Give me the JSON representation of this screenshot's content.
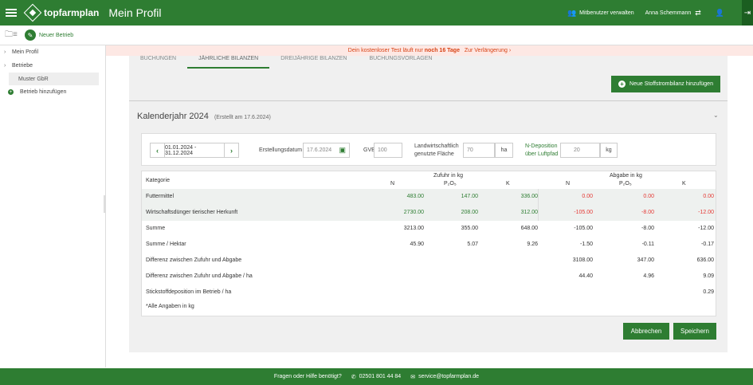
{
  "topbar": {
    "logo_text": "topfarmplan",
    "title": "Mein Profil",
    "mitbenutzer": "Mitbenutzer verwalten",
    "user": "Anna Schemmann"
  },
  "subbar": {
    "new_farm": "Neuer Betrieb"
  },
  "sidebar": {
    "items": [
      {
        "label": "Mein Profil"
      },
      {
        "label": "Betriebe"
      }
    ],
    "sub": "Muster GbR",
    "add": "Betrieb hinzufügen"
  },
  "banner": {
    "prefix": "Dein kostenloser Test läuft nur",
    "highlight": "noch 16 Tage",
    "link": "Zur Verlängerung"
  },
  "tabs": [
    "BUCHUNGEN",
    "JÄHRLICHE BILANZEN",
    "DREIJÄHRIGE BILANZEN",
    "BUCHUNGSVORLAGEN"
  ],
  "add_button": "Neue Stoffstrombilanz hinzufügen",
  "year": {
    "title": "Kalenderjahr 2024",
    "created": "(Erstellt am 17.6.2024)"
  },
  "form": {
    "range": "01.01.2024 - 31.12.2024",
    "erstellungsdatum_label": "Erstellungsdatum",
    "erstellungsdatum": "17.6.2024",
    "gve_label": "GVE",
    "gve": "100",
    "flaeche_label_1": "Landwirtschaftlich",
    "flaeche_label_2": "genutzte Fläche",
    "flaeche": "70",
    "flaeche_unit": "ha",
    "ndep_label_1": "N-Deposition",
    "ndep_label_2": "über Luftpfad",
    "ndep": "20",
    "ndep_unit": "kg"
  },
  "table": {
    "kategorie": "Kategorie",
    "zufuhr": "Zufuhr in kg",
    "abgabe": "Abgabe in kg",
    "cols": [
      "N",
      "P₂O₅",
      "K",
      "N",
      "P₂O₅",
      "K"
    ],
    "rows": [
      {
        "label": "Futtermittel",
        "v": [
          "483.00",
          "147.00",
          "336.00",
          "0.00",
          "0.00",
          "0.00"
        ]
      },
      {
        "label": "Wirtschaftsdünger tierischer Herkunft",
        "v": [
          "2730.00",
          "208.00",
          "312.00",
          "-105.00",
          "-8.00",
          "-12.00"
        ]
      },
      {
        "label": "Summe",
        "v": [
          "3213.00",
          "355.00",
          "648.00",
          "-105.00",
          "-8.00",
          "-12.00"
        ]
      },
      {
        "label": "Summe / Hektar",
        "v": [
          "45.90",
          "5.07",
          "9.26",
          "-1.50",
          "-0.11",
          "-0.17"
        ]
      },
      {
        "label": "Differenz zwischen Zufuhr und Abgabe",
        "v": [
          "",
          "",
          "",
          "3108.00",
          "347.00",
          "636.00"
        ]
      },
      {
        "label": "Differenz zwischen Zufuhr und Abgabe / ha",
        "v": [
          "",
          "",
          "",
          "44.40",
          "4.96",
          "9.09"
        ]
      },
      {
        "label": "Stickstoffdeposition im Betrieb / ha",
        "v": [
          "",
          "",
          "",
          "",
          "",
          "0.29"
        ]
      }
    ],
    "note": "*Alle Angaben in kg"
  },
  "buttons": {
    "cancel": "Abbrechen",
    "save": "Speichern"
  },
  "footer": {
    "help": "Fragen oder Hilfe benötigt?",
    "phone": "02501 801 44 84",
    "email": "service@topfarmplan.de"
  },
  "colors": {
    "primary": "#2e7d32",
    "negative": "#e53935"
  }
}
